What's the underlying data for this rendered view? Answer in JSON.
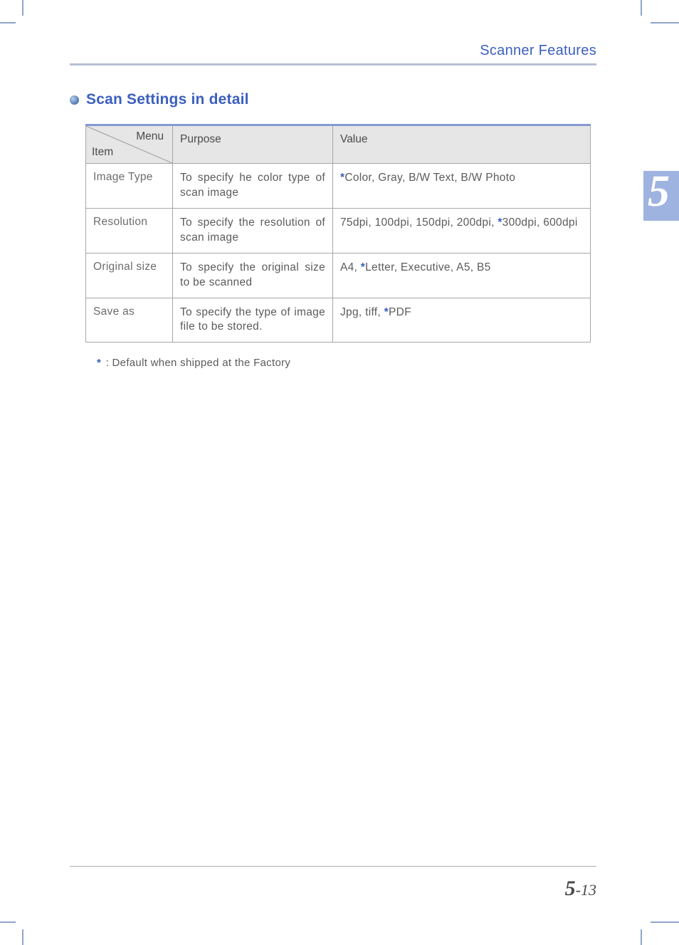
{
  "header": {
    "title": "Scanner Features"
  },
  "section": {
    "heading": "Scan Settings in detail"
  },
  "table": {
    "diag_top": "Menu",
    "diag_bottom": "Item",
    "col_purpose": "Purpose",
    "col_value": "Value",
    "rows": [
      {
        "item": "Image Type",
        "purpose": "To specify he color type of scan image",
        "value_a": "*",
        "value_b": "Color, Gray, B/W Text, B/W Photo",
        "value_c": "",
        "value_d": ""
      },
      {
        "item": "Resolution",
        "purpose": "To specify the resolution of scan image",
        "value_a": "",
        "value_b": "75dpi, 100dpi, 150dpi, 200dpi, ",
        "value_c": "*",
        "value_d": "300dpi, 600dpi"
      },
      {
        "item": "Original size",
        "purpose": "To specify the original size to be scanned",
        "value_a": "",
        "value_b": "A4, ",
        "value_c": "*",
        "value_d": "Letter, Executive, A5, B5"
      },
      {
        "item": "Save as",
        "purpose": "To specify the type of image file to be stored.",
        "value_a": "",
        "value_b": "Jpg, tiff, ",
        "value_c": "*",
        "value_d": "PDF"
      }
    ]
  },
  "footnote": {
    "star": "*",
    "text": " : Default when shipped at the Factory"
  },
  "chapter": {
    "number": "5"
  },
  "pagenum": {
    "chapter": "5",
    "sep": "-",
    "page": "13"
  }
}
